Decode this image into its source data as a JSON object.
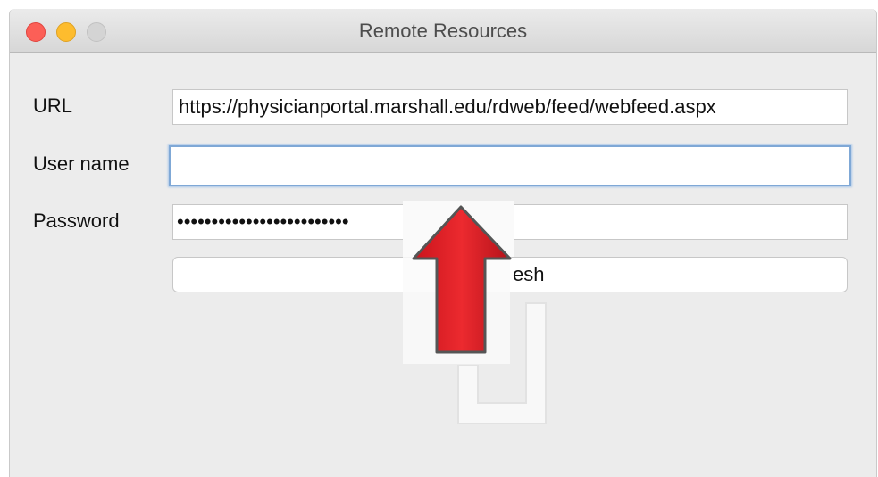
{
  "window": {
    "title": "Remote Resources"
  },
  "form": {
    "url_label": "URL",
    "url_value": "https://physicianportal.marshall.edu/rdweb/feed/webfeed.aspx",
    "username_label": "User name",
    "username_value": "",
    "password_label": "Password",
    "password_value": "•••••••••••••••••••••••••",
    "refresh_label": "esh"
  },
  "annotation": {
    "arrow_icon": "red-up-arrow-icon",
    "arrow_color": "#e8202a",
    "arrow_points_to": "User name"
  },
  "colors": {
    "close": "#fc5f57",
    "minimize": "#fdbc2e",
    "maximize": "#d4d4d4",
    "focus_ring": "#7fa8d6"
  }
}
